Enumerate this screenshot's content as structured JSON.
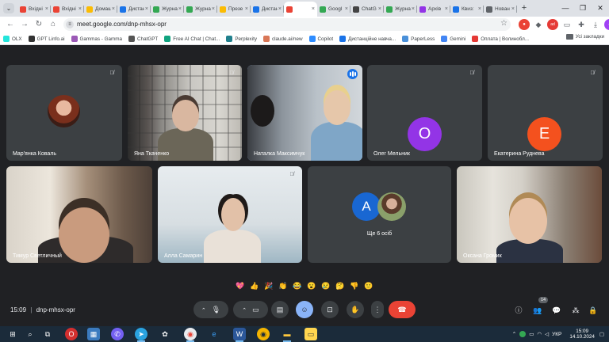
{
  "browser": {
    "tabs": [
      {
        "label": "Вхідні",
        "color": "#ea4335",
        "active": false
      },
      {
        "label": "Вхідні",
        "color": "#ea4335",
        "active": false
      },
      {
        "label": "Домаш",
        "color": "#fbbc04",
        "active": false
      },
      {
        "label": "Дистан",
        "color": "#1a73e8",
        "active": false
      },
      {
        "label": "Журна",
        "color": "#34a853",
        "active": false
      },
      {
        "label": "Журна",
        "color": "#34a853",
        "active": false
      },
      {
        "label": "Презе",
        "color": "#fbbc04",
        "active": false
      },
      {
        "label": "Дистан",
        "color": "#1a73e8",
        "active": false
      },
      {
        "label": "",
        "color": "#ea4335",
        "active": true
      },
      {
        "label": "Googl",
        "color": "#34a853",
        "active": false
      },
      {
        "label": "ChatG",
        "color": "#444444",
        "active": false
      },
      {
        "label": "Журна",
        "color": "#34a853",
        "active": false
      },
      {
        "label": "Архів",
        "color": "#9334e6",
        "active": false
      },
      {
        "label": "Квиз:",
        "color": "#1a73e8",
        "active": false
      },
      {
        "label": "Нован",
        "color": "#5f6368",
        "active": false
      }
    ],
    "url": "meet.google.com/dnp-mhsx-opr",
    "bookmarks": [
      {
        "label": "OLX",
        "color": "#23e5db"
      },
      {
        "label": "GPT Linfo.ai",
        "color": "#333333"
      },
      {
        "label": "Gammas - Gamma",
        "color": "#9b59b6"
      },
      {
        "label": "ChatGPT",
        "color": "#555555"
      },
      {
        "label": "Free AI Chat | Chat...",
        "color": "#10a37f"
      },
      {
        "label": "Perplexity",
        "color": "#20808d"
      },
      {
        "label": "claude.ai/new",
        "color": "#d97757"
      },
      {
        "label": "Copilot",
        "color": "#2d8cff"
      },
      {
        "label": "Дистанційне навча...",
        "color": "#1a73e8"
      },
      {
        "label": "PaperLess",
        "color": "#4a90d9"
      },
      {
        "label": "Gemini",
        "color": "#4285f4"
      },
      {
        "label": "Оплата | Волинобл...",
        "color": "#e53935"
      }
    ],
    "all_bookmarks": "Усі закладки"
  },
  "meet": {
    "tiles": [
      {
        "name": "Мар'янка Коваль"
      },
      {
        "name": "Яна Ткаченко"
      },
      {
        "name": "Наталка Максимчук"
      },
      {
        "name": "Олег Мельник",
        "letter": "O",
        "color": "#9334e6"
      },
      {
        "name": "Екатерина Руднева",
        "letter": "E",
        "color": "#f4511e"
      },
      {
        "name": "Тимур Светличный"
      },
      {
        "name": "Алла Самарин"
      },
      {
        "name": "Ще 6 осіб",
        "letter": "A",
        "color": "#1967d2"
      },
      {
        "name": "Оксана Громик"
      }
    ],
    "reactions": [
      "💖",
      "👍",
      "🎉",
      "👏",
      "😂",
      "😮",
      "😢",
      "🤔",
      "👎",
      "🙂"
    ],
    "time": "15:09",
    "separator": "|",
    "code": "dnp-mhsx-opr",
    "participant_count": "14"
  },
  "taskbar": {
    "lang": "УКР",
    "time": "15:09",
    "date": "14.10.2024"
  }
}
